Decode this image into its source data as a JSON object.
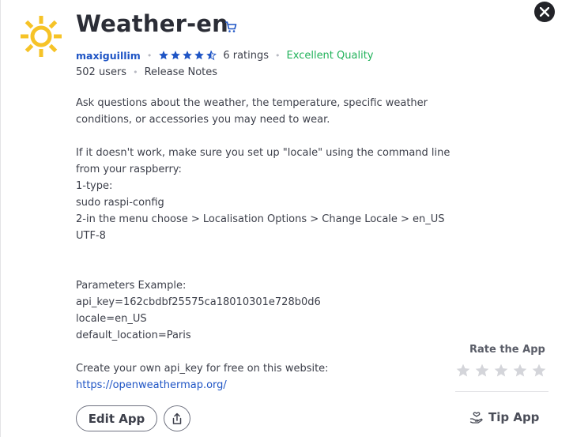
{
  "app": {
    "title": "Weather-en",
    "author": "maxiguillim",
    "rating_value": 4.5,
    "ratings_label": "6 ratings",
    "quality_label": "Excellent Quality",
    "users_label": "502 users",
    "release_notes_label": "Release Notes"
  },
  "description": {
    "lines": [
      "Ask questions about the weather, the temperature, specific weather",
      "conditions, or accessories you may need to wear.",
      "",
      "If it doesn't work, make sure you set up \"locale\" using the command line",
      "from your raspberry:",
      "1-type:",
      "sudo raspi-config",
      "2-in the menu choose > Localisation Options > Change Locale > en_US",
      "UTF-8",
      "",
      "",
      "Parameters Example:",
      "api_key=162cbdbf25575ca18010301e728b0d6",
      "locale=en_US",
      "default_location=Paris",
      "",
      "Create your own api_key for free on this website:"
    ],
    "link": "https://openweathermap.org/"
  },
  "actions": {
    "edit_label": "Edit App",
    "rate_title": "Rate the App",
    "rate_stars": 5,
    "tip_label": "Tip App"
  },
  "colors": {
    "accent_blue": "#1f55c5",
    "quality_green": "#21b25a",
    "icon_yellow": "#f6c327",
    "star_gray": "#d4d5da"
  },
  "icons": [
    "sun-icon",
    "cart-icon",
    "close-icon",
    "star-icon",
    "share-icon",
    "hand-heart-icon"
  ]
}
